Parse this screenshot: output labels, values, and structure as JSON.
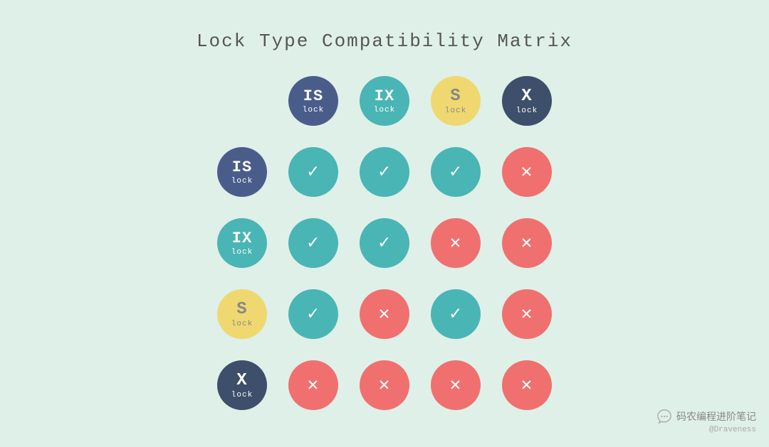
{
  "title": "Lock Type Compatibility Matrix",
  "header_labels": [
    {
      "id": "IS",
      "sub": "lock",
      "color": "color-is"
    },
    {
      "id": "IX",
      "sub": "lock",
      "color": "color-ix"
    },
    {
      "id": "S",
      "sub": "lock",
      "color": "color-s"
    },
    {
      "id": "X",
      "sub": "lock",
      "color": "color-x"
    }
  ],
  "rows": [
    {
      "row_label": {
        "id": "IS",
        "sub": "lock",
        "color": "color-is"
      },
      "cells": [
        {
          "type": "check"
        },
        {
          "type": "check"
        },
        {
          "type": "check"
        },
        {
          "type": "cross"
        }
      ]
    },
    {
      "row_label": {
        "id": "IX",
        "sub": "lock",
        "color": "color-ix"
      },
      "cells": [
        {
          "type": "check"
        },
        {
          "type": "check"
        },
        {
          "type": "cross"
        },
        {
          "type": "cross"
        }
      ]
    },
    {
      "row_label": {
        "id": "S",
        "sub": "lock",
        "color": "color-s"
      },
      "cells": [
        {
          "type": "check"
        },
        {
          "type": "cross"
        },
        {
          "type": "check"
        },
        {
          "type": "cross"
        }
      ]
    },
    {
      "row_label": {
        "id": "X",
        "sub": "lock",
        "color": "color-x"
      },
      "cells": [
        {
          "type": "cross"
        },
        {
          "type": "cross"
        },
        {
          "type": "cross"
        },
        {
          "type": "cross"
        }
      ]
    }
  ],
  "watermark": {
    "main_text": "码农编程进阶笔记",
    "sub_text": "@Draveness"
  }
}
